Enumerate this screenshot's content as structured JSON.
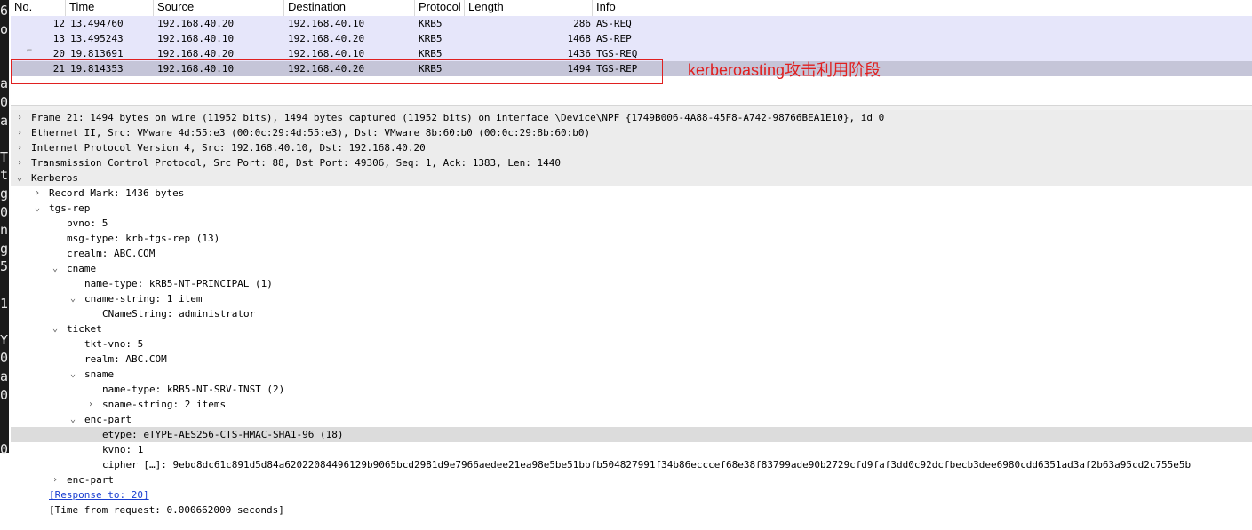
{
  "columns": [
    "No.",
    "Time",
    "Source",
    "Destination",
    "Protocol",
    "Length",
    "Info"
  ],
  "packets": [
    {
      "no": "12",
      "time": "13.494760",
      "src": "192.168.40.20",
      "dst": "192.168.40.10",
      "proto": "KRB5",
      "len": "286",
      "info": "AS-REQ"
    },
    {
      "no": "13",
      "time": "13.495243",
      "src": "192.168.40.10",
      "dst": "192.168.40.20",
      "proto": "KRB5",
      "len": "1468",
      "info": "AS-REP"
    },
    {
      "no": "20",
      "time": "19.813691",
      "src": "192.168.40.20",
      "dst": "192.168.40.10",
      "proto": "KRB5",
      "len": "1436",
      "info": "TGS-REQ"
    },
    {
      "no": "21",
      "time": "19.814353",
      "src": "192.168.40.10",
      "dst": "192.168.40.20",
      "proto": "KRB5",
      "len": "1494",
      "info": "TGS-REP"
    }
  ],
  "annotation": "kerberoasting攻击利用阶段",
  "left_fragments": [
    "6(",
    "o:",
    "",
    "",
    "a",
    "0",
    "a",
    "",
    "T",
    "t",
    "g",
    "0",
    "n",
    "g",
    "5",
    "",
    "1",
    "",
    "Y",
    "0",
    "a",
    "0",
    "",
    "",
    "0"
  ],
  "details": [
    {
      "text": "Frame 21: 1494 bytes on wire (11952 bits), 1494 bytes captured (11952 bits) on interface \\Device\\NPF_{1749B006-4A88-45F8-A742-98766BEA1E10}, id 0",
      "lvl": 0,
      "tog": "›",
      "bg": "gray"
    },
    {
      "text": "Ethernet II, Src: VMware_4d:55:e3 (00:0c:29:4d:55:e3), Dst: VMware_8b:60:b0 (00:0c:29:8b:60:b0)",
      "lvl": 0,
      "tog": "›",
      "bg": "gray"
    },
    {
      "text": "Internet Protocol Version 4, Src: 192.168.40.10, Dst: 192.168.40.20",
      "lvl": 0,
      "tog": "›",
      "bg": "gray"
    },
    {
      "text": "Transmission Control Protocol, Src Port: 88, Dst Port: 49306, Seq: 1, Ack: 1383, Len: 1440",
      "lvl": 0,
      "tog": "›",
      "bg": "gray"
    },
    {
      "text": "Kerberos",
      "lvl": 0,
      "tog": "⌄",
      "bg": "gray"
    },
    {
      "text": "Record Mark: 1436 bytes",
      "lvl": 1,
      "tog": "›",
      "bg": ""
    },
    {
      "text": "tgs-rep",
      "lvl": 1,
      "tog": "⌄",
      "bg": ""
    },
    {
      "text": "pvno: 5",
      "lvl": 2,
      "tog": "",
      "bg": ""
    },
    {
      "text": "msg-type: krb-tgs-rep (13)",
      "lvl": 2,
      "tog": "",
      "bg": ""
    },
    {
      "text": "crealm: ABC.COM",
      "lvl": 2,
      "tog": "",
      "bg": ""
    },
    {
      "text": "cname",
      "lvl": 2,
      "tog": "⌄",
      "bg": ""
    },
    {
      "text": "name-type: kRB5-NT-PRINCIPAL (1)",
      "lvl": 3,
      "tog": "",
      "bg": ""
    },
    {
      "text": "cname-string: 1 item",
      "lvl": 3,
      "tog": "⌄",
      "bg": ""
    },
    {
      "text": "CNameString: administrator",
      "lvl": 4,
      "tog": "",
      "bg": ""
    },
    {
      "text": "ticket",
      "lvl": 2,
      "tog": "⌄",
      "bg": ""
    },
    {
      "text": "tkt-vno: 5",
      "lvl": 3,
      "tog": "",
      "bg": ""
    },
    {
      "text": "realm: ABC.COM",
      "lvl": 3,
      "tog": "",
      "bg": ""
    },
    {
      "text": "sname",
      "lvl": 3,
      "tog": "⌄",
      "bg": ""
    },
    {
      "text": "name-type: kRB5-NT-SRV-INST (2)",
      "lvl": 4,
      "tog": "",
      "bg": ""
    },
    {
      "text": "sname-string: 2 items",
      "lvl": 4,
      "tog": "›",
      "bg": ""
    },
    {
      "text": "enc-part",
      "lvl": 3,
      "tog": "⌄",
      "bg": ""
    },
    {
      "text": "etype: eTYPE-AES256-CTS-HMAC-SHA1-96 (18)",
      "lvl": 4,
      "tog": "",
      "bg": "sel"
    },
    {
      "text": "kvno: 1",
      "lvl": 4,
      "tog": "",
      "bg": ""
    },
    {
      "text": "cipher […]: 9ebd8dc61c891d5d84a62022084496129b9065bcd2981d9e7966aedee21ea98e5be51bbfb504827991f34b86ecccef68e38f83799ade90b2729cfd9faf3dd0c92dcfbecb3dee6980cdd6351ad3af2b63a95cd2c755e5b",
      "lvl": 4,
      "tog": "",
      "bg": ""
    },
    {
      "text": "enc-part",
      "lvl": 2,
      "tog": "›",
      "bg": ""
    },
    {
      "text": "[Response to: 20]",
      "lvl": 1,
      "tog": "",
      "bg": "",
      "link": true
    },
    {
      "text": "[Time from request: 0.000662000 seconds]",
      "lvl": 1,
      "tog": "",
      "bg": ""
    }
  ]
}
